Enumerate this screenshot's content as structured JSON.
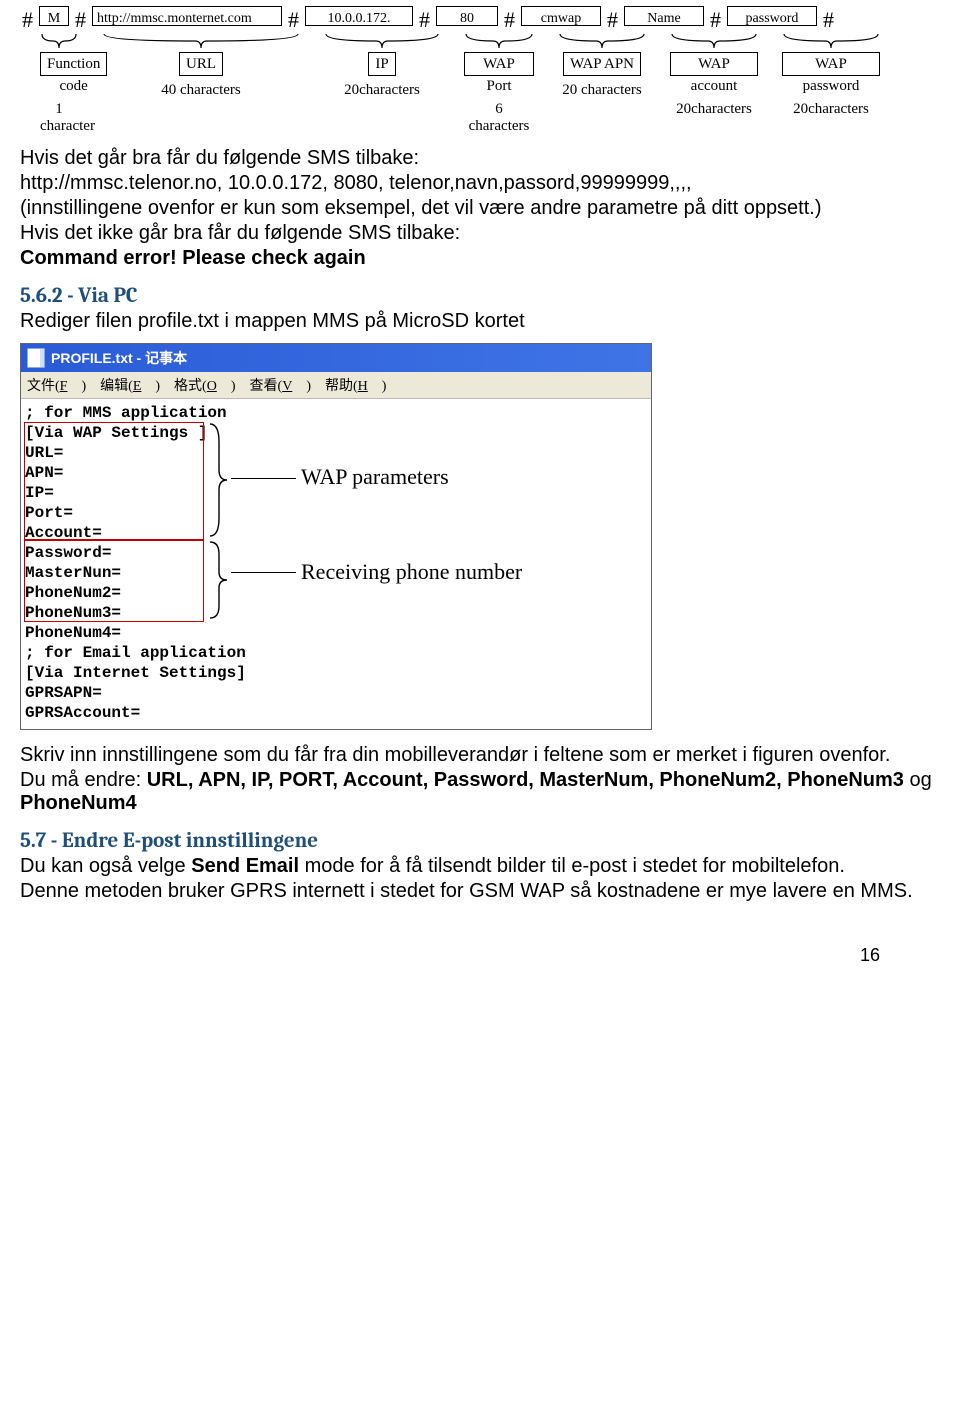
{
  "diagram": {
    "fields": [
      {
        "hash": "#",
        "value": "M",
        "class": "c-m",
        "label": "Function code",
        "sub": "1 character",
        "brace_w": 38
      },
      {
        "hash": "#",
        "value": "http://mmsc.monternet.com",
        "class": "c-url",
        "label": "URL",
        "sub": "40 characters",
        "brace_w": 198
      },
      {
        "hash": "#",
        "value": "10.0.0.172.",
        "class": "c-ip",
        "label": "IP",
        "sub": "20characters",
        "brace_w": 116
      },
      {
        "hash": "#",
        "value": "80",
        "class": "c-port",
        "label": "WAP Port",
        "sub": "6 characters",
        "brace_w": 70
      },
      {
        "hash": "#",
        "value": "cmwap",
        "class": "c-apn",
        "label": "WAP APN",
        "sub": "20 characters",
        "brace_w": 88
      },
      {
        "hash": "#",
        "value": "Name",
        "class": "c-name",
        "label": "WAP account",
        "sub": "20characters",
        "brace_w": 88
      },
      {
        "hash": "#",
        "value": "password",
        "class": "c-pw",
        "label": "WAP password",
        "sub": "20characters",
        "brace_w": 98
      }
    ],
    "trailing_hash": "#"
  },
  "text": {
    "p1": "Hvis det går bra får du følgende SMS tilbake:",
    "p2": "http://mmsc.telenor.no, 10.0.0.172, 8080, telenor,navn,passord,99999999,,,,",
    "p3": "(innstillingene ovenfor er kun som eksempel, det vil være andre parametre på ditt oppsett.)",
    "p4": "Hvis det ikke går bra får du følgende SMS tilbake:",
    "p5": "Command error! Please check again",
    "h562": "5.6.2 - Via PC",
    "p6": "Rediger filen profile.txt i mappen MMS på MicroSD kortet",
    "p7": "Skriv inn innstillingene som du får fra din mobilleverandør i feltene som er merket i figuren ovenfor.",
    "p8a": "Du må endre: ",
    "p8b": "URL, APN, IP, PORT, Account, Password, MasterNum, PhoneNum2, PhoneNum3",
    "p8c": " og ",
    "p8d": "PhoneNum4",
    "h57": "5.7 - Endre E-post innstillingene",
    "p9a": "Du kan også velge ",
    "p9b": "Send Email",
    "p9c": " mode for å få tilsendt bilder til e-post i stedet for mobiltelefon.",
    "p10": "Denne metoden bruker GPRS internett i stedet for GSM WAP så kostnadene er mye lavere en MMS."
  },
  "notepad": {
    "title": "PROFILE.txt - 记事本",
    "menu": [
      "文件(F)",
      "编辑(E)",
      "格式(O)",
      "查看(V)",
      "帮助(H)"
    ],
    "lines": [
      "; for MMS application",
      "[Via WAP Settings ]",
      "URL=",
      "APN=",
      "IP=",
      "Port=",
      "Account=",
      "Password=",
      "MasterNun=",
      "PhoneNum2=",
      "PhoneNum3=",
      "PhoneNum4=",
      "; for Email application",
      "[Via Internet Settings]",
      "GPRSAPN=",
      "GPRSAccount="
    ],
    "annot1": "WAP parameters",
    "annot2": "Receiving phone number"
  },
  "page_number": "16"
}
